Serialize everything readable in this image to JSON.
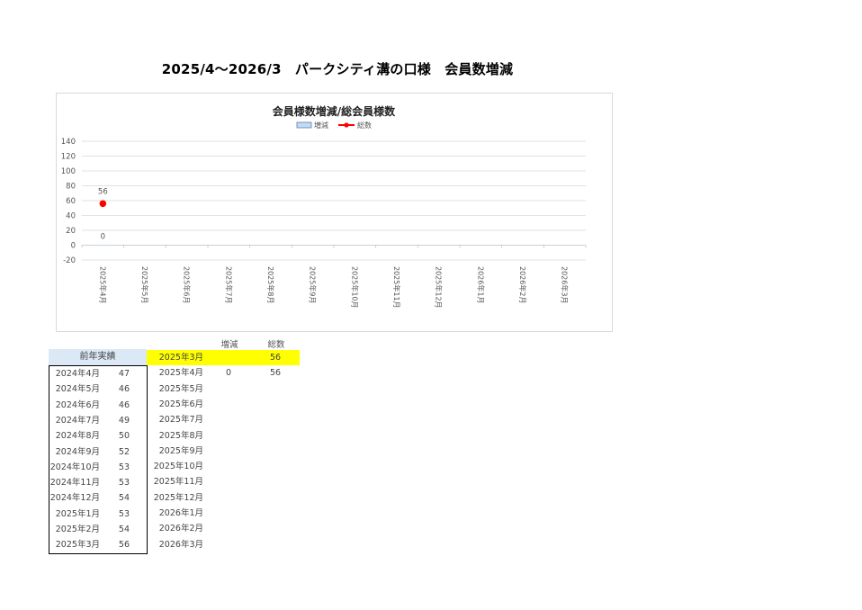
{
  "page_title": "2025/4～2026/3　パークシティ溝の口様　会員数増減",
  "chart_data": {
    "type": "bar",
    "title": "会員様数増減/総会員様数",
    "legend": [
      "増減",
      "総数"
    ],
    "legend_position": "top",
    "categories": [
      "2025年4月",
      "2025年5月",
      "2025年6月",
      "2025年7月",
      "2025年8月",
      "2025年9月",
      "2025年10月",
      "2025年11月",
      "2025年12月",
      "2026年1月",
      "2026年2月",
      "2026年3月"
    ],
    "series": [
      {
        "name": "増減",
        "kind": "bar",
        "color": "#c6d9f1",
        "values": [
          0,
          null,
          null,
          null,
          null,
          null,
          null,
          null,
          null,
          null,
          null,
          null
        ]
      },
      {
        "name": "総数",
        "kind": "line",
        "color": "#ff0000",
        "values": [
          56,
          null,
          null,
          null,
          null,
          null,
          null,
          null,
          null,
          null,
          null,
          null
        ]
      }
    ],
    "ylim": [
      -20,
      140
    ],
    "yticks": [
      "-20",
      "0",
      "20",
      "40",
      "60",
      "80",
      "100",
      "120",
      "140"
    ],
    "grid": true,
    "data_labels": {
      "total": "56",
      "change": "0"
    }
  },
  "prev_year": {
    "header": "前年実績",
    "rows": [
      {
        "month": "2024年4月",
        "value": "47"
      },
      {
        "month": "2024年5月",
        "value": "46"
      },
      {
        "month": "2024年6月",
        "value": "46"
      },
      {
        "month": "2024年7月",
        "value": "49"
      },
      {
        "month": "2024年8月",
        "value": "50"
      },
      {
        "month": "2024年9月",
        "value": "52"
      },
      {
        "month": "2024年10月",
        "value": "53"
      },
      {
        "month": "2024年11月",
        "value": "53"
      },
      {
        "month": "2024年12月",
        "value": "54"
      },
      {
        "month": "2025年1月",
        "value": "53"
      },
      {
        "month": "2025年2月",
        "value": "54"
      },
      {
        "month": "2025年3月",
        "value": "56"
      }
    ]
  },
  "current": {
    "col_change": "増減",
    "col_total": "総数",
    "rows": [
      {
        "month": "2025年3月",
        "change": "",
        "total": "56"
      },
      {
        "month": "2025年4月",
        "change": "0",
        "total": "56"
      },
      {
        "month": "2025年5月",
        "change": "",
        "total": ""
      },
      {
        "month": "2025年6月",
        "change": "",
        "total": ""
      },
      {
        "month": "2025年7月",
        "change": "",
        "total": ""
      },
      {
        "month": "2025年8月",
        "change": "",
        "total": ""
      },
      {
        "month": "2025年9月",
        "change": "",
        "total": ""
      },
      {
        "month": "2025年10月",
        "change": "",
        "total": ""
      },
      {
        "month": "2025年11月",
        "change": "",
        "total": ""
      },
      {
        "month": "2025年12月",
        "change": "",
        "total": ""
      },
      {
        "month": "2026年1月",
        "change": "",
        "total": ""
      },
      {
        "month": "2026年2月",
        "change": "",
        "total": ""
      },
      {
        "month": "2026年3月",
        "change": "",
        "total": ""
      }
    ],
    "highlight_color": "#ffff00"
  }
}
